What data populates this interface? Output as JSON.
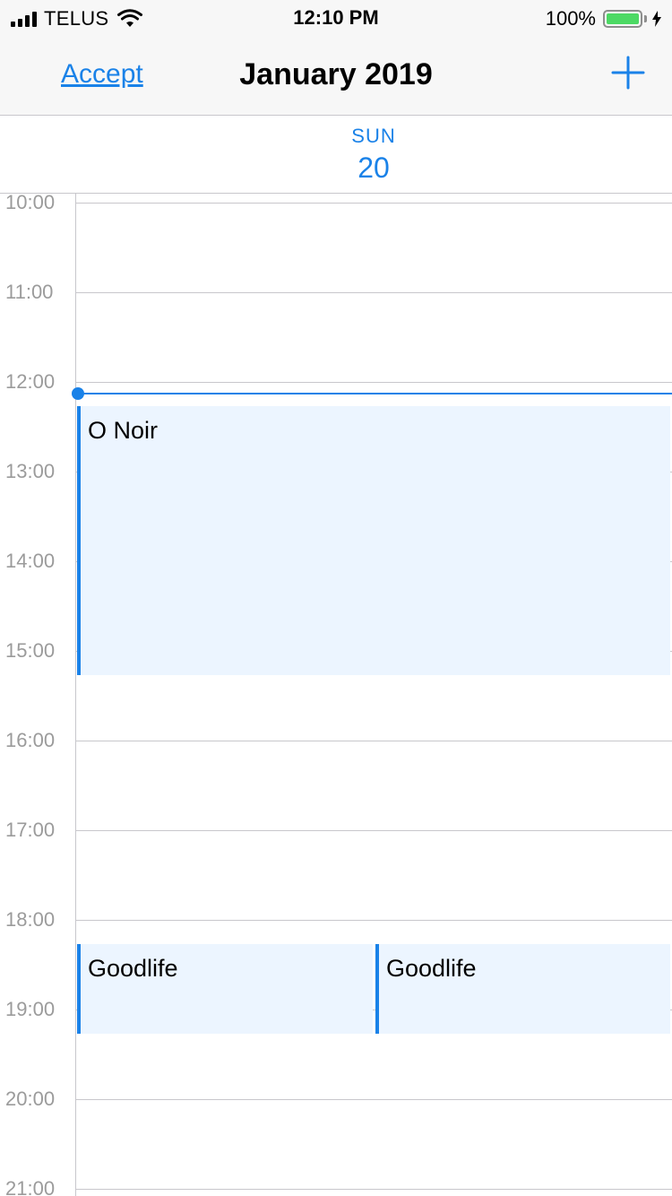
{
  "status_bar": {
    "carrier": "TELUS",
    "time": "12:10 PM",
    "battery": "100%",
    "battery_level": 1.0,
    "icons": [
      "cellular-signal-icon",
      "wifi-icon",
      "battery-icon",
      "charging-bolt-icon"
    ]
  },
  "nav": {
    "accept_label": "Accept",
    "title": "January 2019",
    "add_icon": "plus-icon"
  },
  "day_header": {
    "day_name": "SUN",
    "day_number": "20"
  },
  "timeline": {
    "hours": [
      "10:00",
      "11:00",
      "12:00",
      "13:00",
      "14:00",
      "15:00",
      "16:00",
      "17:00",
      "18:00",
      "19:00",
      "20:00",
      "21:00"
    ],
    "current_time": "12:10"
  },
  "events": [
    {
      "title": "O Noir",
      "start": "12:15",
      "end": "15:15"
    },
    {
      "title": "Goodlife",
      "start": "18:15",
      "end": "19:15"
    },
    {
      "title": "Goodlife",
      "start": "18:15",
      "end": "19:15"
    }
  ],
  "colors": {
    "accent": "#1a82e8",
    "event_background": "#ecf5ff",
    "battery_green": "#4cd964",
    "hour_label": "#9b9b9b",
    "grid_line": "#c8c7cc"
  }
}
